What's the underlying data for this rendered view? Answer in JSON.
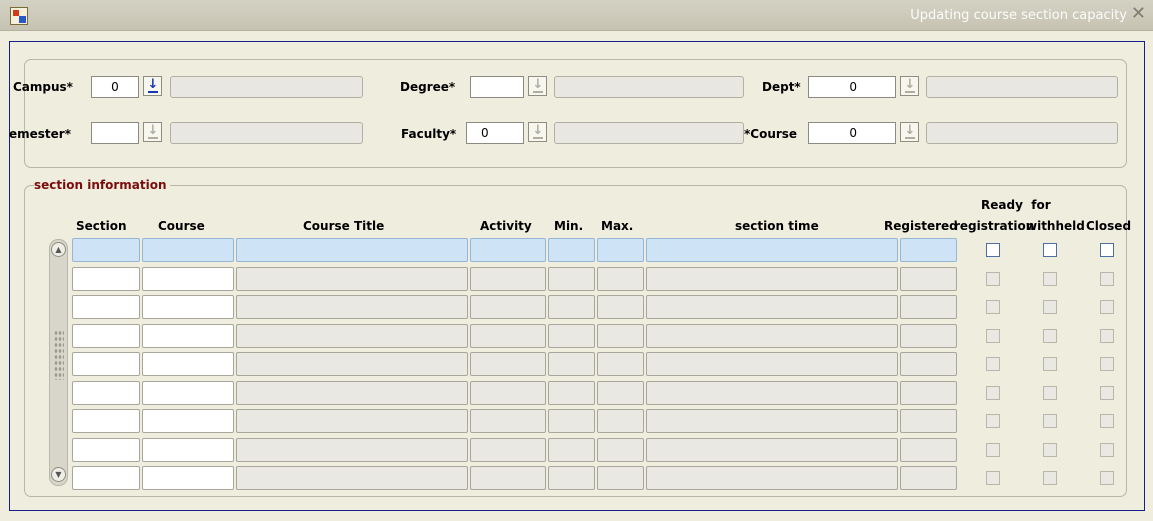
{
  "window": {
    "title": "Updating course section capacity",
    "close": "✕"
  },
  "header": {
    "campus": {
      "label": "Campus*",
      "value": "0"
    },
    "semester": {
      "label": "emester*",
      "value": ""
    },
    "degree": {
      "label": "Degree*",
      "value": ""
    },
    "faculty": {
      "label": "Faculty*",
      "value": "0"
    },
    "dept": {
      "label": "Dept*",
      "value": "0"
    },
    "course": {
      "label": "Course*",
      "value": "0"
    }
  },
  "section": {
    "title": "section information",
    "columns": {
      "section": "Section",
      "course": "Course",
      "course_title": "Course Title",
      "activity": "Activity",
      "min": "Min.",
      "max": "Max.",
      "section_time": "section time",
      "registered": "Registered",
      "ready_line1": "Ready  for",
      "ready_line2": "registration",
      "withheld": "withheld",
      "closed": "Closed"
    },
    "row_count": 9
  },
  "icons": {
    "lov": "down-arrow-lov-icon",
    "scroll_up": "scroll-up-icon",
    "scroll_down": "scroll-down-icon",
    "app": "app-icon"
  },
  "colors": {
    "section_title": "#7a0c0c",
    "selected_row": "#cfe3f7",
    "frame": "#1a1e8c"
  }
}
